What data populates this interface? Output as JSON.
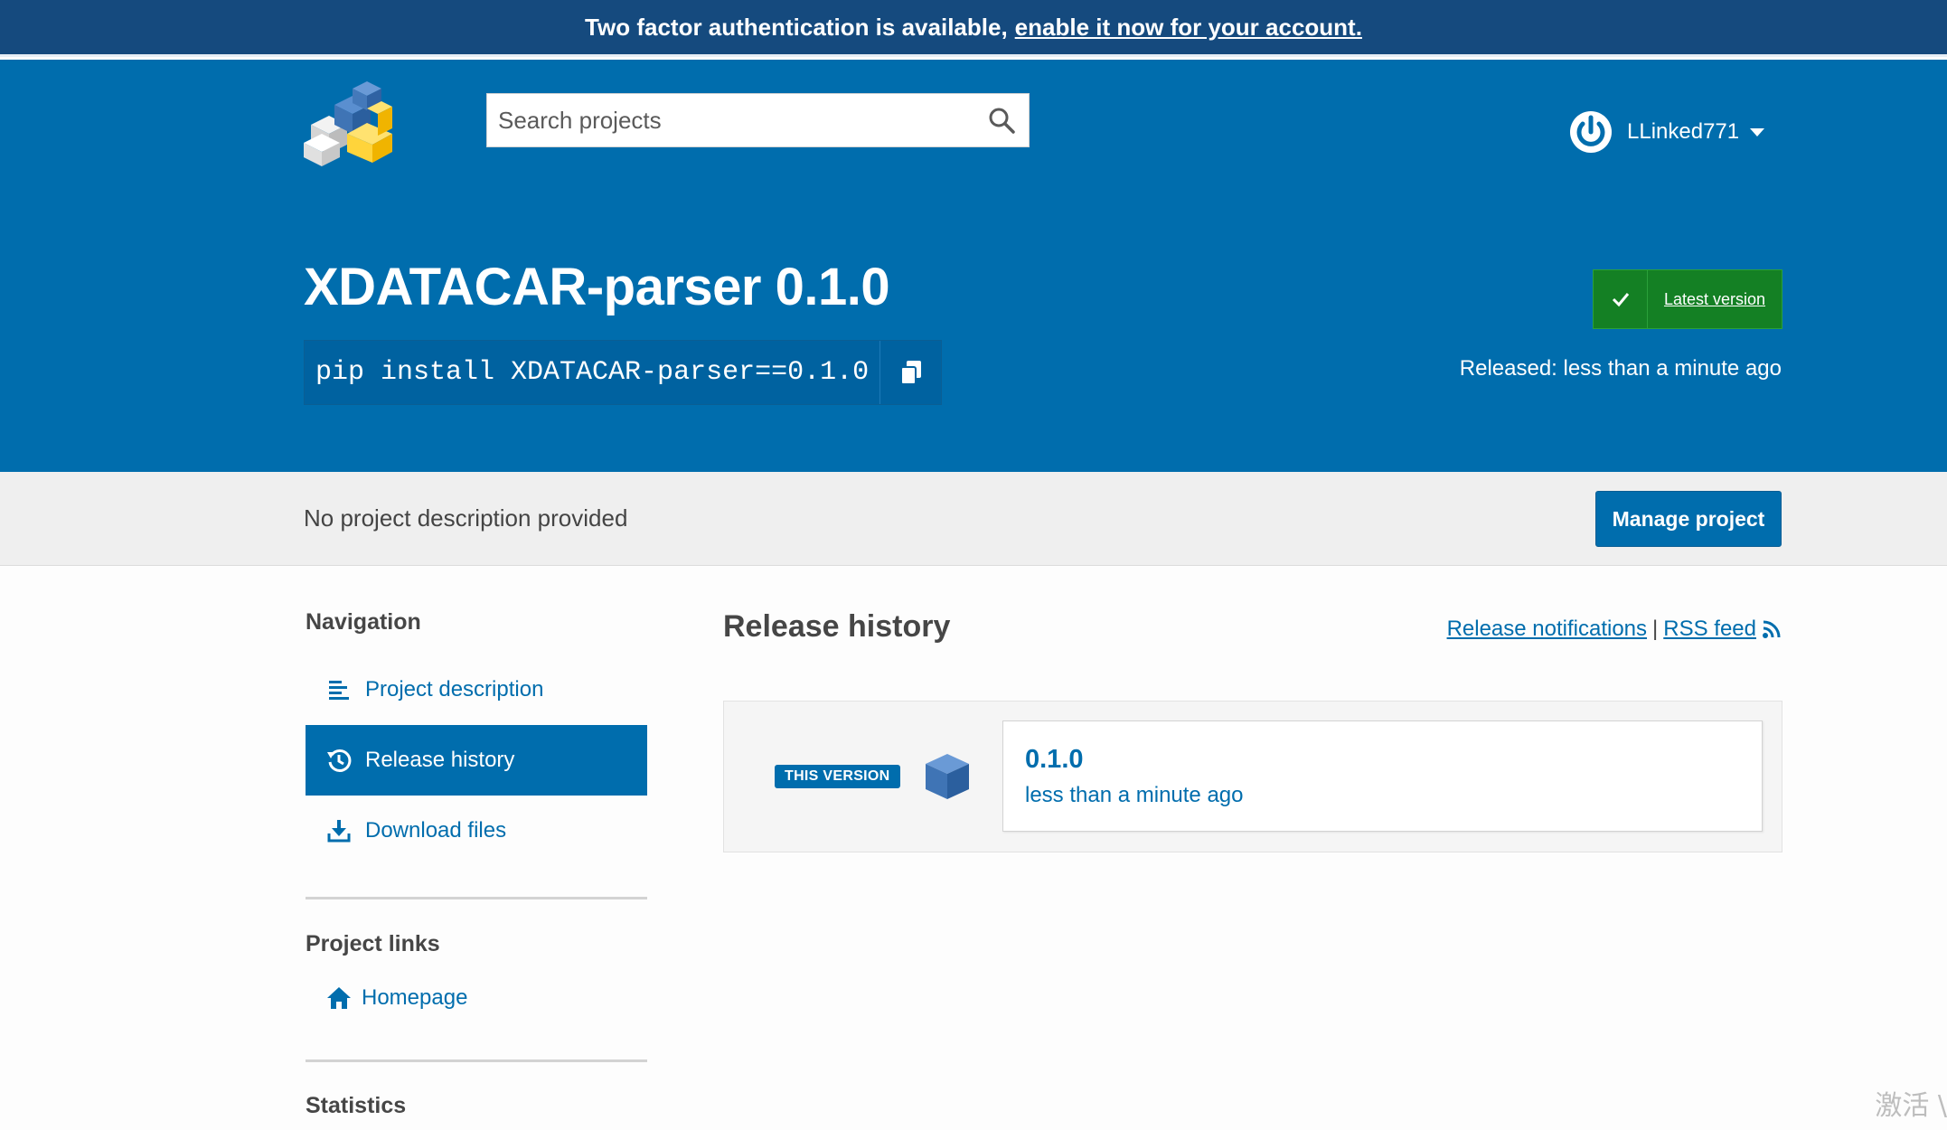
{
  "banner": {
    "text": "Two factor authentication is available,",
    "link": "enable it now for your account."
  },
  "header": {
    "logo_icon": "pypi-logo-icon",
    "search": {
      "placeholder": "Search projects",
      "value": "",
      "icon": "search-icon"
    },
    "user": {
      "icon": "power-icon",
      "name": "LLinked771",
      "dropdown_icon": "caret-down-icon"
    }
  },
  "project": {
    "title": "XDATACAR-parser 0.1.0",
    "pip_command": "pip install XDATACAR-parser==0.1.0",
    "copy_icon": "copy-icon",
    "latest_version_label": "Latest version",
    "released": "Released: less than a minute ago",
    "description": "No project description provided",
    "manage_label": "Manage project"
  },
  "sidebar": {
    "navigation_heading": "Navigation",
    "nav_items": [
      {
        "label": "Project description",
        "icon": "align-left-icon",
        "active": false
      },
      {
        "label": "Release history",
        "icon": "history-icon",
        "active": true
      },
      {
        "label": "Download files",
        "icon": "download-icon",
        "active": false
      }
    ],
    "project_links_heading": "Project links",
    "links": [
      {
        "label": "Homepage",
        "icon": "home-icon"
      }
    ],
    "statistics_heading": "Statistics"
  },
  "release_history": {
    "title": "Release history",
    "notifications_link": "Release notifications",
    "separator": "|",
    "rss_link": "RSS feed",
    "releases": [
      {
        "badge": "THIS VERSION",
        "version": "0.1.0",
        "date": "less than a minute ago"
      }
    ]
  },
  "watermark": "激活 \\",
  "colors": {
    "primary": "#006dad",
    "banner": "#154a7e",
    "success": "#148024"
  }
}
